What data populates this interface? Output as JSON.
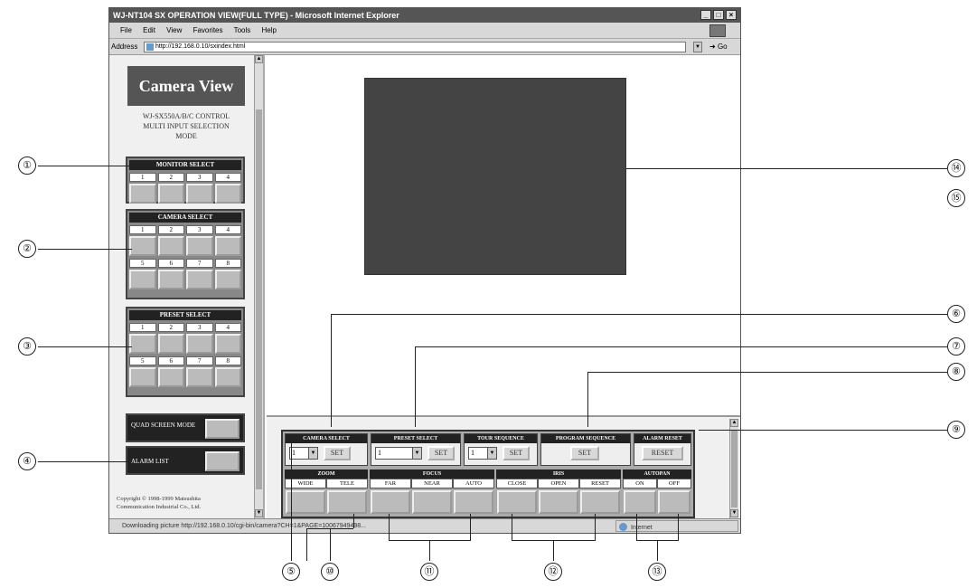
{
  "window": {
    "title": "WJ-NT104 SX OPERATION VIEW(FULL TYPE) - Microsoft Internet Explorer",
    "menu": [
      "File",
      "Edit",
      "View",
      "Favorites",
      "Tools",
      "Help"
    ],
    "address_label": "Address",
    "address_url": "http://192.168.0.10/sxindex.html",
    "go_label": "Go"
  },
  "sidebar": {
    "logo": "Camera View",
    "mode_lines": [
      "WJ-SX550A/B/C CONTROL",
      "MULTI INPUT SELECTION",
      "MODE"
    ],
    "monitor_select": {
      "title": "MONITOR SELECT",
      "numbers": [
        "1",
        "2",
        "3",
        "4"
      ]
    },
    "camera_select": {
      "title": "CAMERA SELECT",
      "numbers_row1": [
        "1",
        "2",
        "3",
        "4"
      ],
      "numbers_row2": [
        "5",
        "6",
        "7",
        "8"
      ]
    },
    "preset_select": {
      "title": "PRESET SELECT",
      "numbers_row1": [
        "1",
        "2",
        "3",
        "4"
      ],
      "numbers_row2": [
        "5",
        "6",
        "7",
        "8"
      ]
    },
    "quad_screen_label": "QUAD SCREEN MODE",
    "alarm_list_label": "ALARM LIST",
    "copyright_lines": [
      "Copyright © 1998-1999 Matsushita",
      "Communication Industrial Co., Ltd."
    ]
  },
  "controls": {
    "camera_select": {
      "title": "CAMERA SELECT",
      "value": "1",
      "set": "SET"
    },
    "preset_select": {
      "title": "PRESET SELECT",
      "value": "1",
      "set": "SET"
    },
    "tour_sequence": {
      "title": "TOUR SEQUENCE",
      "value": "1",
      "set": "SET"
    },
    "program_sequence": {
      "title": "PROGRAM SEQUENCE",
      "set": "SET"
    },
    "alarm_reset": {
      "title": "ALARM RESET",
      "reset": "RESET"
    },
    "zoom": {
      "title": "ZOOM",
      "labels": [
        "WIDE",
        "TELE"
      ]
    },
    "focus": {
      "title": "FOCUS",
      "labels": [
        "FAR",
        "NEAR",
        "AUTO"
      ]
    },
    "iris": {
      "title": "IRIS",
      "labels": [
        "CLOSE",
        "OPEN",
        "RESET"
      ]
    },
    "autopan": {
      "title": "AUTOPAN",
      "labels": [
        "ON",
        "OFF"
      ]
    }
  },
  "statusbar": {
    "text": "Downloading picture http://192.168.0.10/cgi-bin/camera?CH=1&PAGE=10067949498...",
    "zone": "Internet"
  },
  "callouts": [
    "①",
    "②",
    "③",
    "④",
    "⑤",
    "⑥",
    "⑦",
    "⑧",
    "⑨",
    "⑩",
    "⑪",
    "⑫",
    "⑬",
    "⑭",
    "⑮"
  ]
}
